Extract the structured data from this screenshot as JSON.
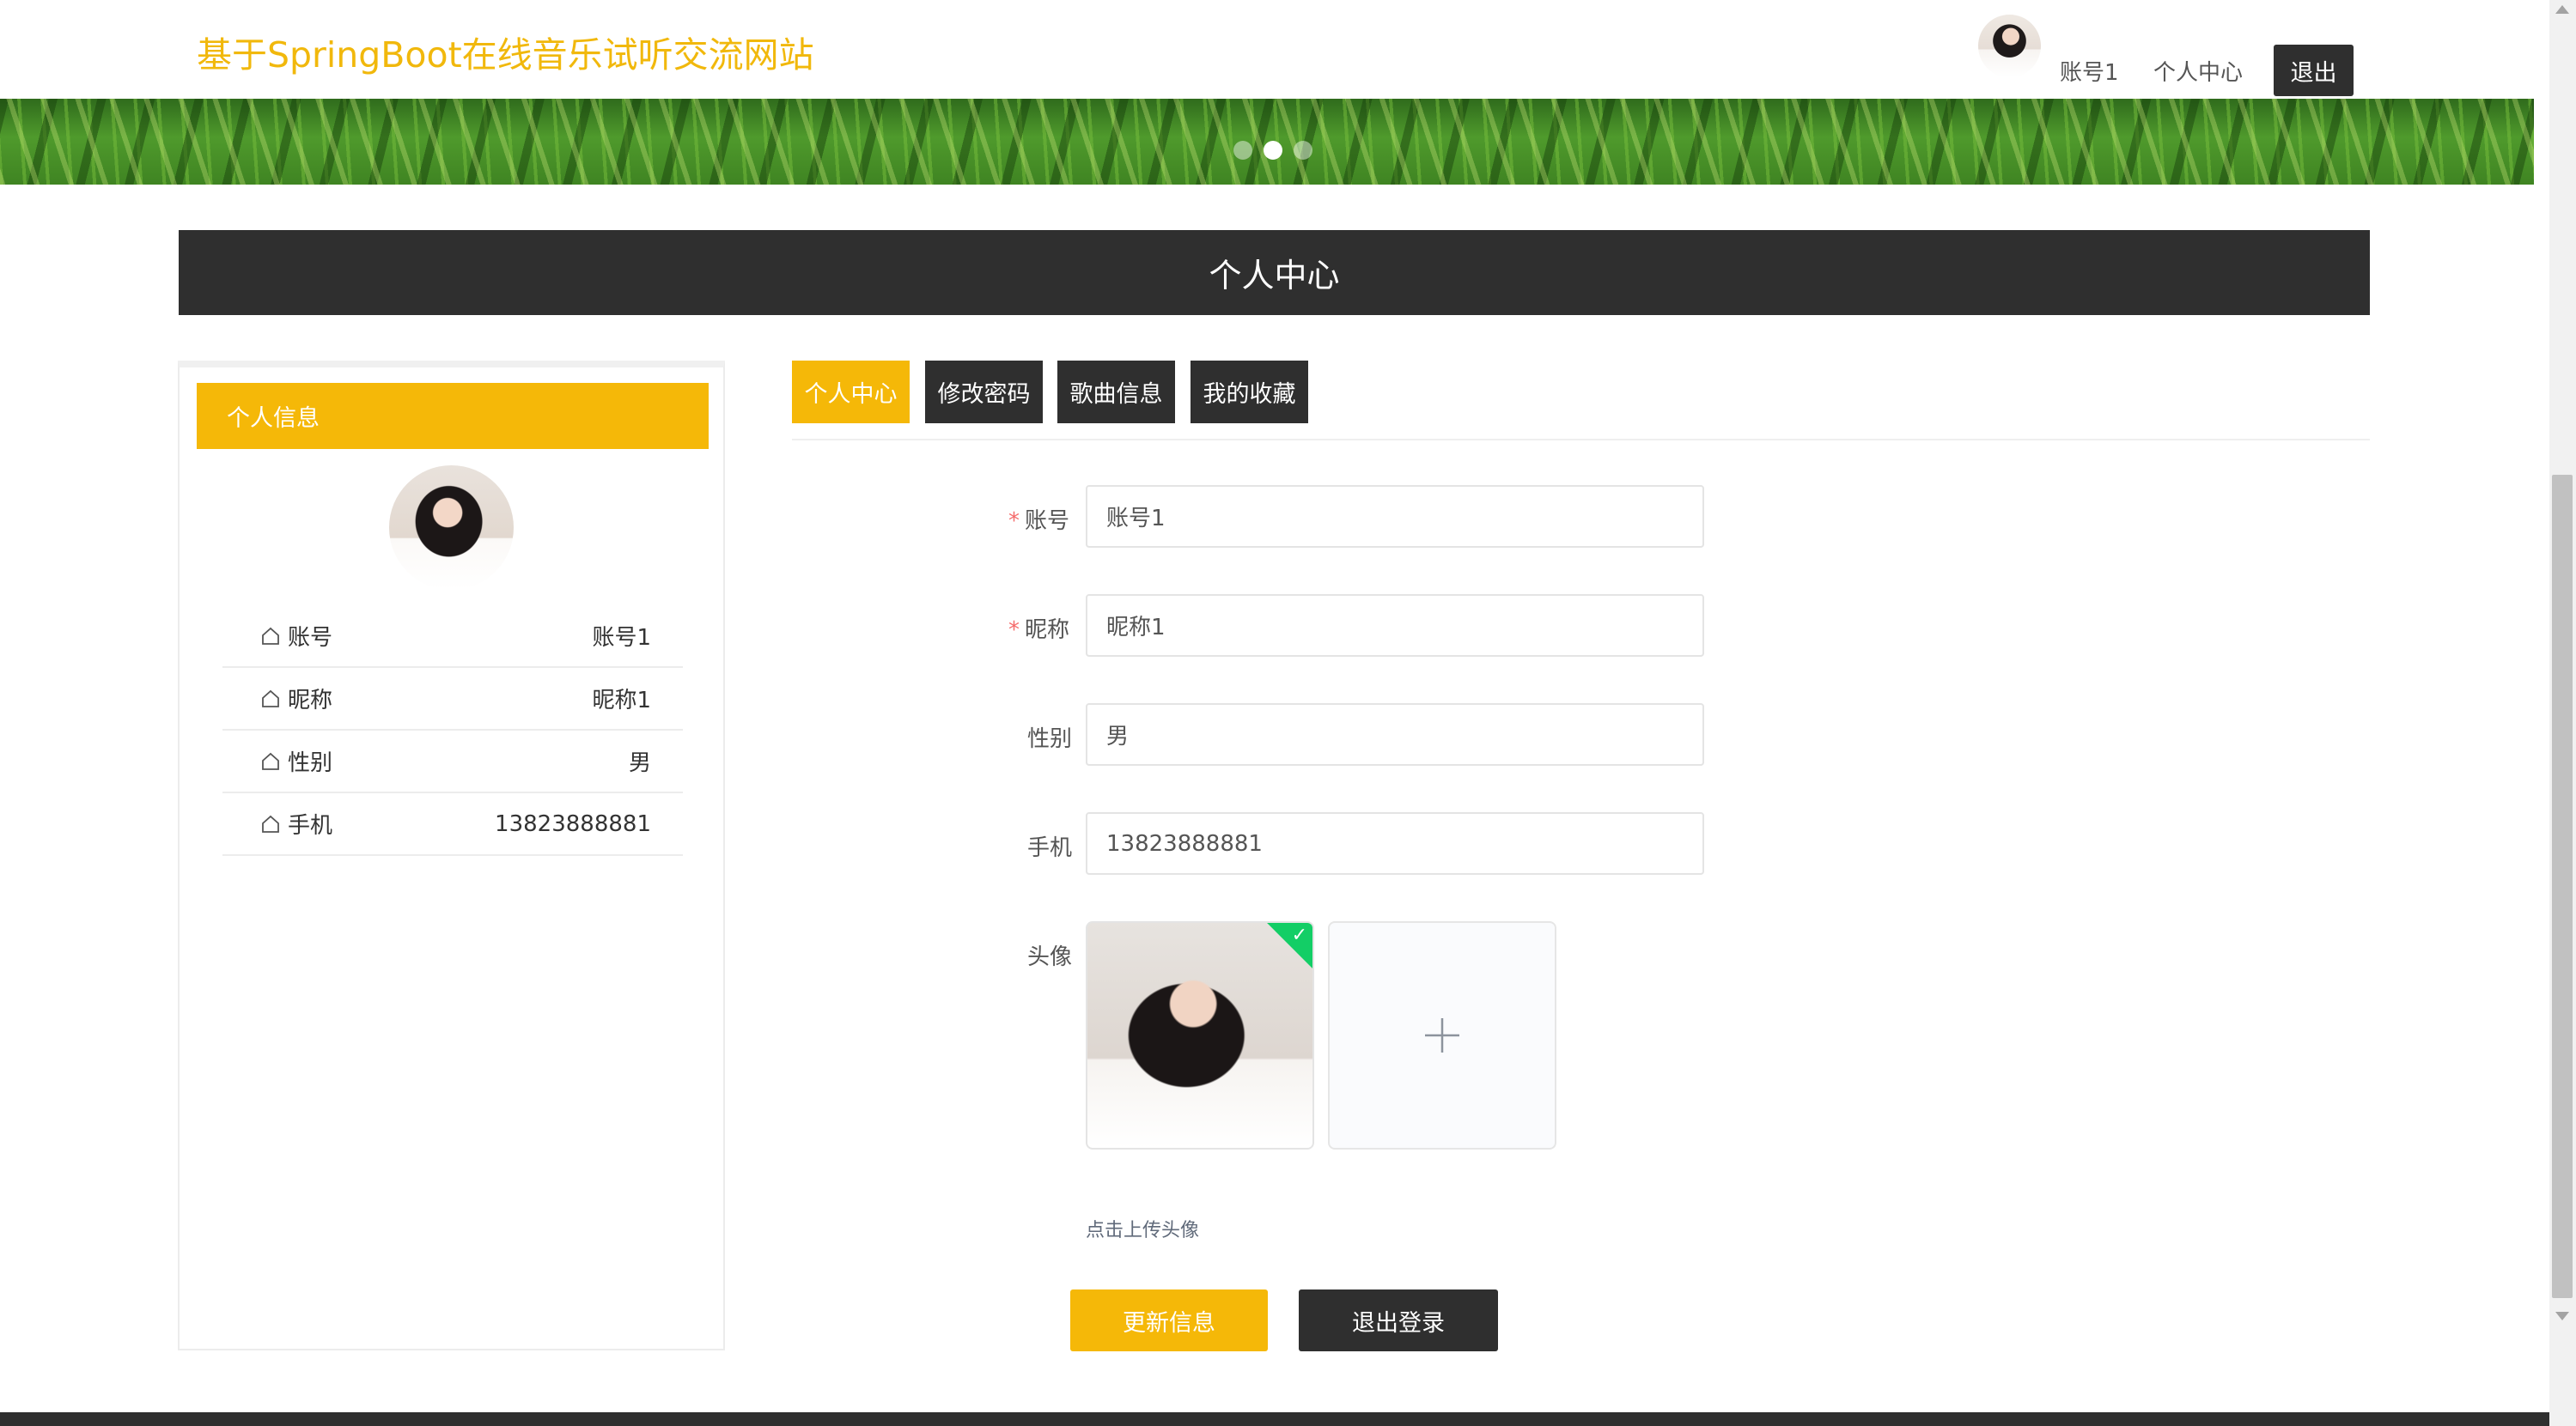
{
  "header": {
    "site_title": "基于SpringBoot在线音乐试听交流网站",
    "username": "账号1",
    "personal_center": "个人中心",
    "logout": "退出"
  },
  "banner": {
    "slide_count": 3,
    "active_slide": 2
  },
  "section_title": "个人中心",
  "profile_card": {
    "title": "个人信息",
    "rows": [
      {
        "icon": "home-icon",
        "label": "账号",
        "value": "账号1"
      },
      {
        "icon": "home-icon",
        "label": "昵称",
        "value": "昵称1"
      },
      {
        "icon": "home-icon",
        "label": "性别",
        "value": "男"
      },
      {
        "icon": "home-icon",
        "label": "手机",
        "value": "13823888881"
      }
    ]
  },
  "tabs": [
    {
      "label": "个人中心",
      "active": true
    },
    {
      "label": "修改密码",
      "active": false
    },
    {
      "label": "歌曲信息",
      "active": false
    },
    {
      "label": "我的收藏",
      "active": false
    }
  ],
  "form": {
    "account": {
      "label": "账号",
      "required": "*",
      "value": "账号1"
    },
    "nickname": {
      "label": "昵称",
      "required": "*",
      "value": "昵称1"
    },
    "gender": {
      "label": "性别",
      "value": "男"
    },
    "phone": {
      "label": "手机",
      "value": "13823888881"
    },
    "avatar": {
      "label": "头像",
      "tip": "点击上传头像",
      "upload_icon": "plus-icon"
    },
    "update_button": "更新信息",
    "logout_button": "退出登录"
  },
  "colors": {
    "accent": "#f5b808",
    "title": "#f1b80c",
    "dark": "#2f2f2f",
    "success": "#13ce66",
    "required": "#f56c6c"
  }
}
